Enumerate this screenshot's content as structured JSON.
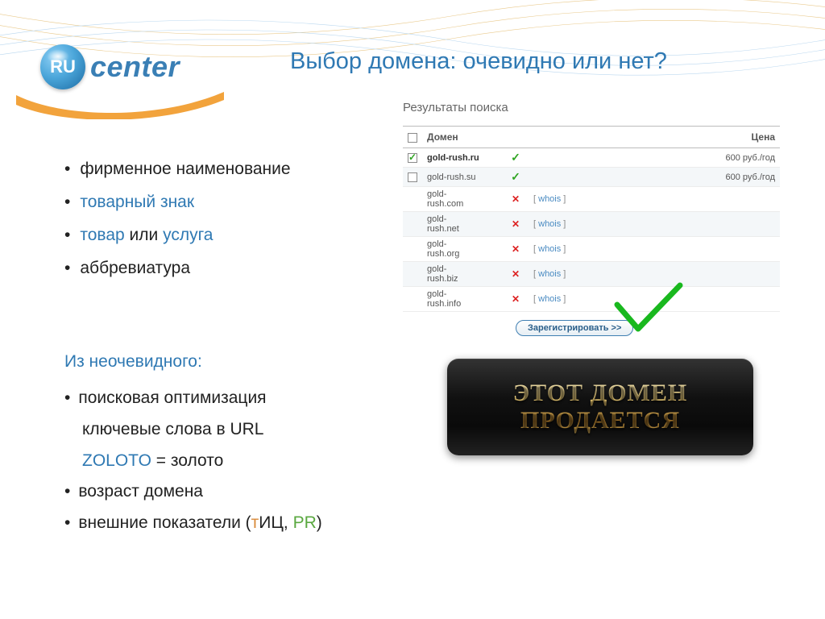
{
  "logo": {
    "badge": "RU",
    "text": "center"
  },
  "title": "Выбор домена: очевидно или нет?",
  "left_list": [
    {
      "text": "фирменное наименование",
      "accent": false
    },
    {
      "parts": [
        "товарный знак"
      ],
      "accent_all": true
    },
    {
      "mixed": [
        {
          "t": "товар",
          "accent": true
        },
        {
          "t": " или ",
          "accent": false
        },
        {
          "t": "услуга",
          "accent": true
        }
      ]
    },
    {
      "text": "аббревиатура",
      "accent": false
    }
  ],
  "bottom": {
    "heading": "Из неочевидного:",
    "items": [
      "поисковая оптимизация",
      "ключевые слова в URL",
      {
        "mixed": [
          {
            "t": "ZOLOTO",
            "cls": "accent"
          },
          {
            "t": " = золото",
            "cls": ""
          }
        ]
      },
      "возраст домена",
      {
        "mixed": [
          {
            "t": "внешние показатели (",
            "cls": ""
          },
          {
            "t": "т",
            "cls": "accent-orange"
          },
          {
            "t": "ИЦ",
            "cls": ""
          },
          {
            "t": ", ",
            "cls": ""
          },
          {
            "t": "PR",
            "cls": "accent-green"
          },
          {
            "t": ")",
            "cls": ""
          }
        ]
      }
    ]
  },
  "panel": {
    "title": "Результаты поиска",
    "head": {
      "domain": "Домен",
      "price": "Цена"
    },
    "whois_label": "whois",
    "register_label": "Зарегистрировать >>",
    "rows": [
      {
        "checked": true,
        "domain": "gold-rush.ru",
        "available": true,
        "whois": false,
        "price": "600 руб./год"
      },
      {
        "checked": false,
        "domain": "gold-rush.su",
        "available": true,
        "whois": false,
        "price": "600 руб./год"
      },
      {
        "checked": null,
        "domain": "gold-rush.com",
        "available": false,
        "whois": true,
        "price": ""
      },
      {
        "checked": null,
        "domain": "gold-rush.net",
        "available": false,
        "whois": true,
        "price": ""
      },
      {
        "checked": null,
        "domain": "gold-rush.org",
        "available": false,
        "whois": true,
        "price": ""
      },
      {
        "checked": null,
        "domain": "gold-rush.biz",
        "available": false,
        "whois": true,
        "price": ""
      },
      {
        "checked": null,
        "domain": "gold-rush.info",
        "available": false,
        "whois": true,
        "price": ""
      }
    ]
  },
  "banner": {
    "line1": "ЭТОТ ДОМЕН",
    "line2": "ПРОДАЕТСЯ"
  }
}
